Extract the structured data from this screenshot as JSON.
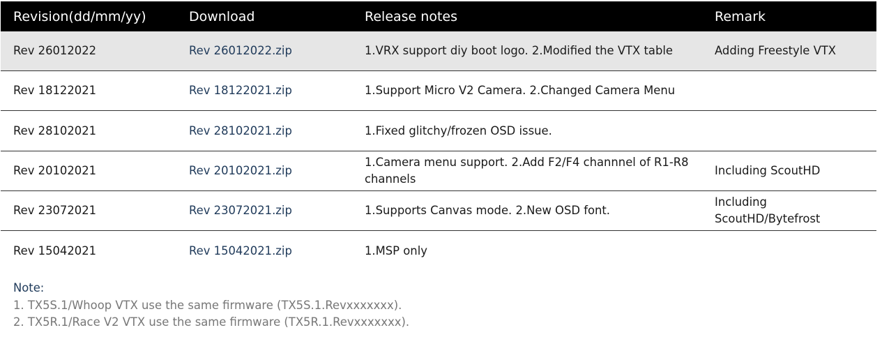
{
  "table": {
    "headers": [
      "Revision(dd/mm/yy)",
      "Download",
      "Release notes",
      "Remark"
    ],
    "rows": [
      {
        "revision": "Rev 26012022",
        "download": "Rev 26012022.zip",
        "notes": "1.VRX support diy boot logo. 2.Modified the VTX table",
        "remark": "Adding Freestyle VTX"
      },
      {
        "revision": "Rev 18122021",
        "download": "Rev 18122021.zip",
        "notes": "1.Support Micro V2 Camera. 2.Changed Camera Menu",
        "remark": ""
      },
      {
        "revision": "Rev 28102021",
        "download": "Rev 28102021.zip",
        "notes": "1.Fixed glitchy/frozen OSD issue.",
        "remark": ""
      },
      {
        "revision": "Rev 20102021",
        "download": "Rev 20102021.zip",
        "notes": "1.Camera menu support. 2.Add F2/F4 channnel of R1-R8 channels",
        "remark": "Including ScoutHD"
      },
      {
        "revision": "Rev 23072021",
        "download": "Rev 23072021.zip",
        "notes": "1.Supports Canvas mode. 2.New OSD font.",
        "remark": "Including ScoutHD/Bytefrost"
      },
      {
        "revision": "Rev 15042021",
        "download": "Rev 15042021.zip",
        "notes": "1.MSP only",
        "remark": ""
      }
    ]
  },
  "notes": {
    "title": "Note:",
    "lines": [
      "1. TX5S.1/Whoop VTX use the same firmware (TX5S.1.Revxxxxxxx).",
      "2. TX5R.1/Race V2 VTX use the same firmware (TX5R.1.Revxxxxxxx)."
    ]
  },
  "colors": {
    "header_bg": "#000000",
    "header_text": "#ffffff",
    "highlight_row": "#e6e6e6",
    "link": "#1f3a5a",
    "note_text": "#777777"
  }
}
